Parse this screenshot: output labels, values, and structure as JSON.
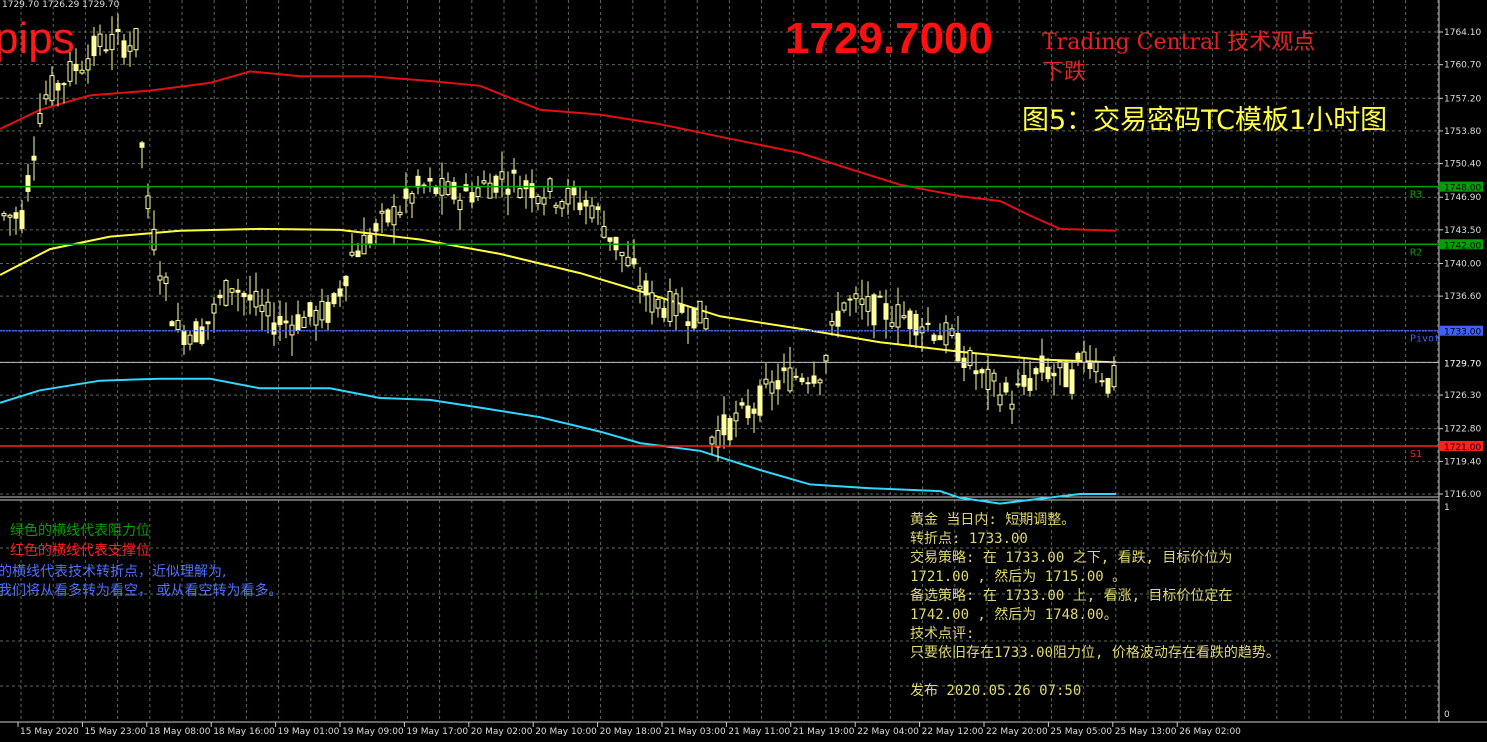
{
  "header": {
    "ohlc": "1729.70 1726.29 1729.70",
    "pips": "pips",
    "price": "1729.7000",
    "source": "Trading Central 技术观点",
    "direction": "下跌",
    "figure_title": "图5：交易密码TC模板1小时图"
  },
  "axis": {
    "ticks": [
      "1764.10",
      "1760.70",
      "1757.20",
      "1753.80",
      "1750.40",
      "1746.90",
      "1743.50",
      "1740.00",
      "1736.60",
      "1733.00",
      "1729.70",
      "1726.30",
      "1722.80",
      "1719.40",
      "1716.00"
    ],
    "sub_ticks": [
      "1",
      "0"
    ],
    "time_labels": [
      "15 May 2020",
      "15 May 23:00",
      "18 May 08:00",
      "18 May 16:00",
      "19 May 01:00",
      "19 May 09:00",
      "19 May 17:00",
      "20 May 02:00",
      "20 May 10:00",
      "20 May 18:00",
      "21 May 03:00",
      "21 May 11:00",
      "21 May 19:00",
      "22 May 04:00",
      "22 May 12:00",
      "22 May 20:00",
      "25 May 05:00",
      "25 May 13:00",
      "26 May 02:00"
    ]
  },
  "levels": {
    "r3": {
      "label": "R3",
      "value": "1748.00",
      "color": "#00a000"
    },
    "r2": {
      "label": "R2",
      "value": "1742.00",
      "color": "#00a000"
    },
    "pivot": {
      "label": "Pivot",
      "value": "1733.00",
      "color": "#4060ff"
    },
    "current": {
      "value": "1729.70",
      "color": "#c0c0c0"
    },
    "s1": {
      "label": "S1",
      "value": "1721.00",
      "color": "#ff2020"
    }
  },
  "legend": {
    "green": "绿色的横线代表阻力位",
    "red": "红色的横线代表支撑位",
    "blue1": "的横线代表技术转折点，近似理解为,",
    "blue2": "我们将从看多转为看空， 或从看空转为看多。"
  },
  "panel": {
    "lines": [
      "黄金 当日内: 短期调整。",
      "转折点: 1733.00",
      "交易策略: 在 1733.00 之下, 看跌, 目标价位为",
      "1721.00 , 然后为 1715.00 。",
      "备选策略: 在 1733.00 上, 看涨, 目标价位定在",
      "1742.00 , 然后为 1748.00。",
      "技术点评:",
      "只要依旧存在1733.00阻力位, 价格波动存在看跌的趋势。",
      "",
      "发布 2020.05.26 07:50"
    ]
  },
  "colors": {
    "background": "#000000",
    "grid": "#5a6a5a",
    "candle": "#ffffa0",
    "ma_red": "#e01010",
    "ma_yellow": "#ffff40",
    "ma_cyan": "#30d8ff",
    "legend_green": "#00a000",
    "legend_red": "#ff2020",
    "legend_blue": "#5070ff"
  }
}
